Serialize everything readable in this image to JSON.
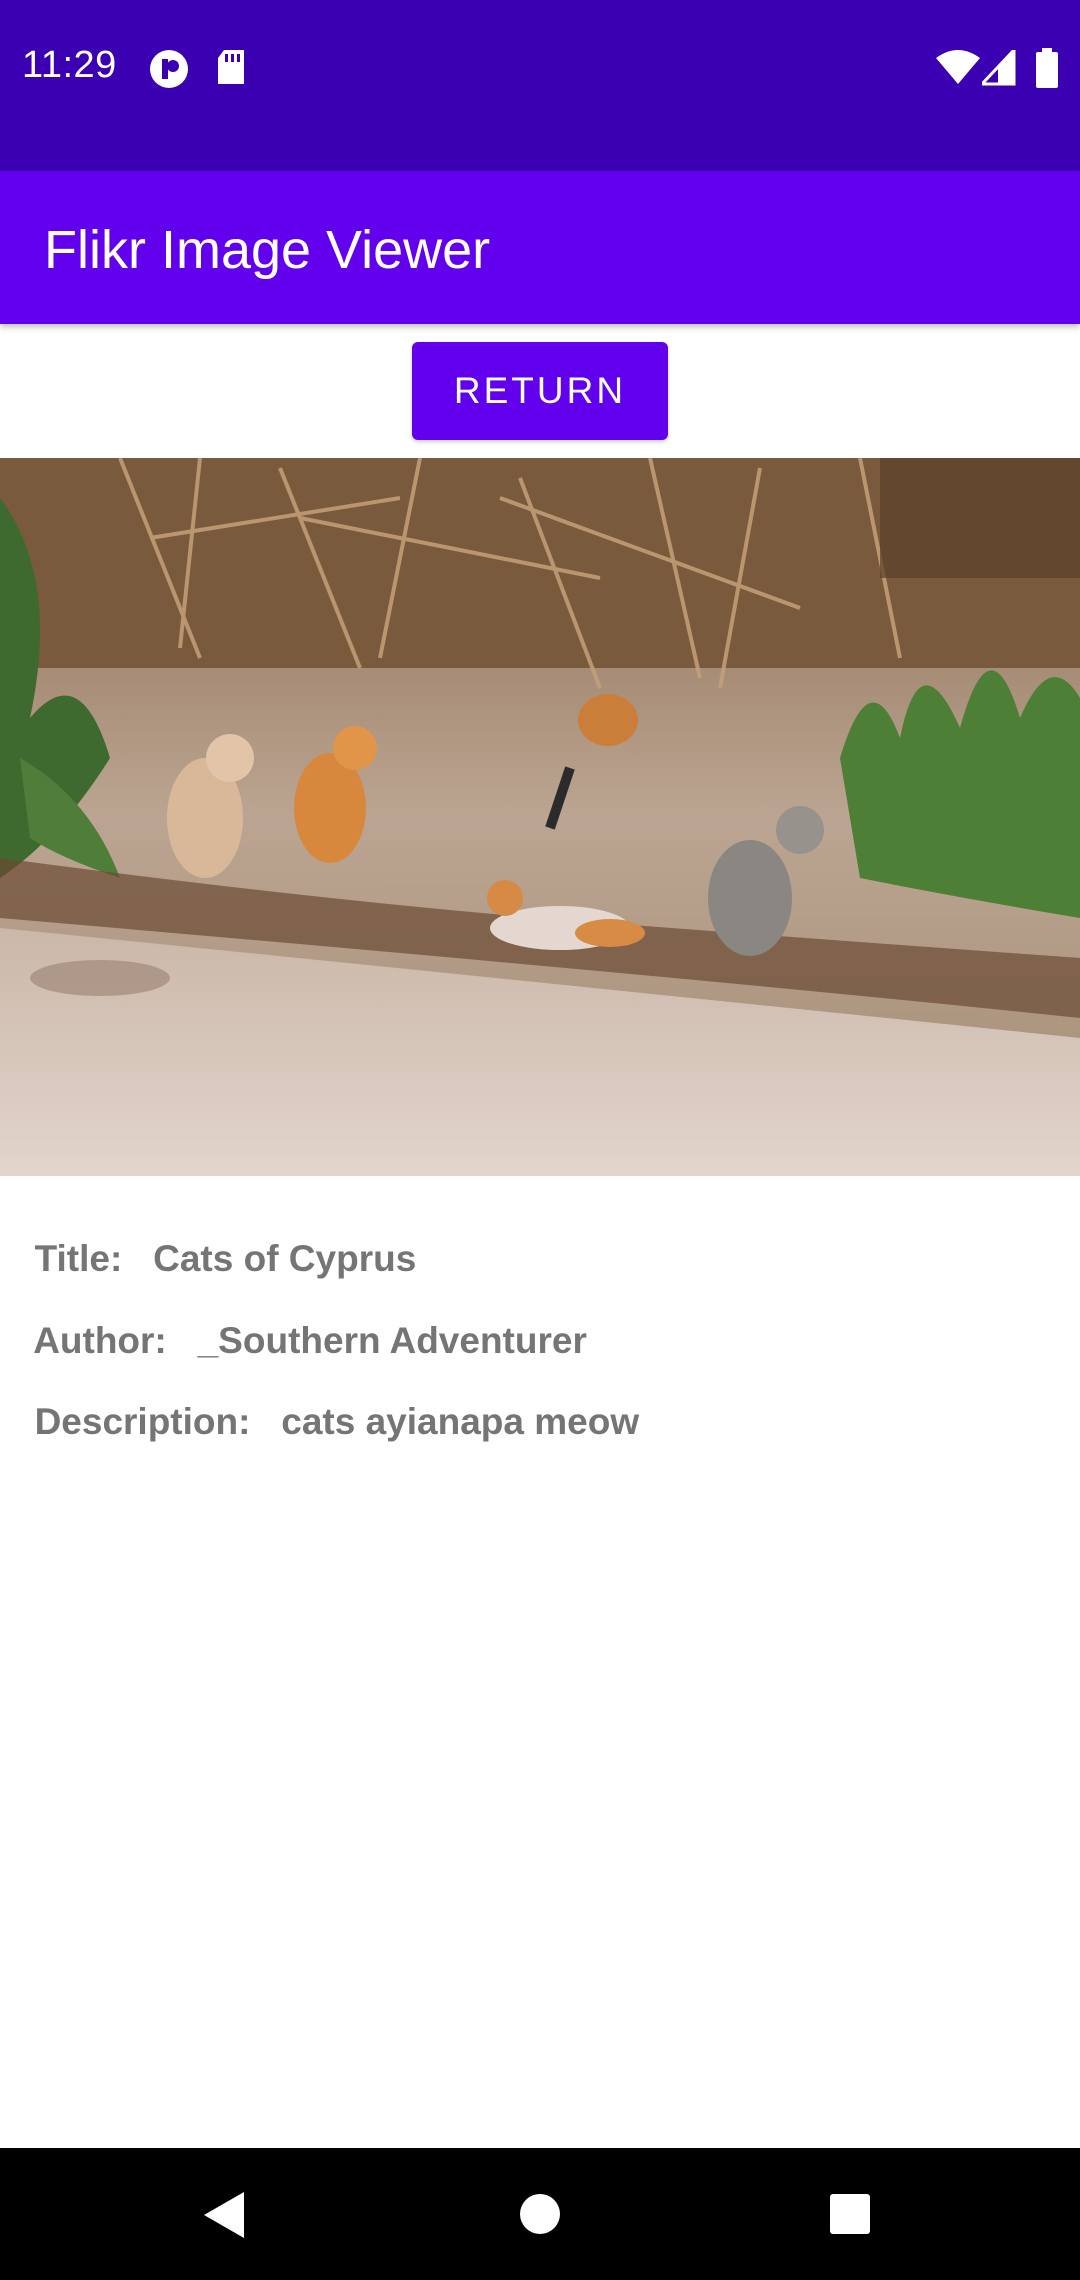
{
  "status_bar": {
    "time": "11:29",
    "left_icons": [
      "app-notification-icon",
      "sd-card-icon"
    ],
    "right_icons": [
      "wifi-icon",
      "cellular-signal-icon",
      "battery-icon"
    ]
  },
  "app_bar": {
    "title": "Flikr Image Viewer"
  },
  "return_button": {
    "label": "RETURN"
  },
  "image": {
    "description_icon": "photo-image"
  },
  "details": {
    "title_label": "Title:",
    "title_value": "Cats of Cyprus",
    "author_label": "Author:",
    "author_value": "_Southern Adventurer",
    "description_label": "Description:",
    "description_value": "cats ayianapa meow"
  },
  "nav_bar": {
    "icons": [
      "back-icon",
      "home-icon",
      "recents-icon"
    ]
  },
  "colors": {
    "status_bar": "#3A00B1",
    "primary": "#6200EE",
    "detail_text": "#757575"
  }
}
